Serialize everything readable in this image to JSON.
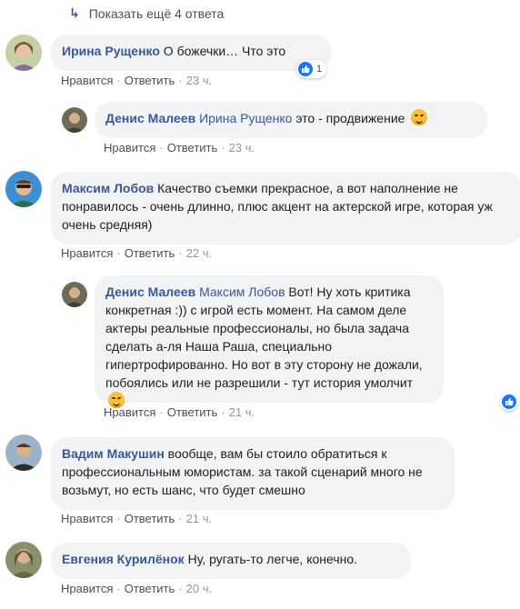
{
  "show_more": {
    "arrow": "↳",
    "label": "Показать ещё 4 ответа"
  },
  "actions": {
    "like": "Нравится",
    "reply": "Ответить"
  },
  "comments": [
    {
      "author": "Ирина Рущенко",
      "text": "О божечки… Что это",
      "time": "23 ч.",
      "likes": "1"
    },
    {
      "author": "Денис Малеев",
      "mention": "Ирина Рущенко",
      "text": "это - продвижение",
      "time": "23 ч."
    },
    {
      "author": "Максим Лобов",
      "text": "Качество съемки прекрасное, а вот наполнение не понравилось - очень длинно, плюс акцент на актерской игре, которая уж очень средняя)",
      "time": "22 ч."
    },
    {
      "author": "Денис Малеев",
      "mention": "Максим Лобов",
      "text": "Вот! Ну хоть критика конкретная :)) с игрой есть момент. На самом деле актеры реальные профессионалы, но была задача сделать а-ля Наша Раша, специально гипертрофированно. Но вот в эту сторону не дожали, побоялись или не разрешили - тут история умолчит",
      "time": "21 ч."
    },
    {
      "author": "Вадим Макушин",
      "text": "вообще, вам бы стоило обратиться к профессиональным юмористам. за такой сценарий много не возьмут, но есть шанс, что будет смешно",
      "time": "21 ч."
    },
    {
      "author": "Евгения Курилёнок",
      "text": "Ну, ругать-то легче, конечно.",
      "time": "20 ч."
    }
  ],
  "colors": {
    "link": "#385898",
    "bubble": "#f2f3f5",
    "like_blue": "#1877f2"
  }
}
